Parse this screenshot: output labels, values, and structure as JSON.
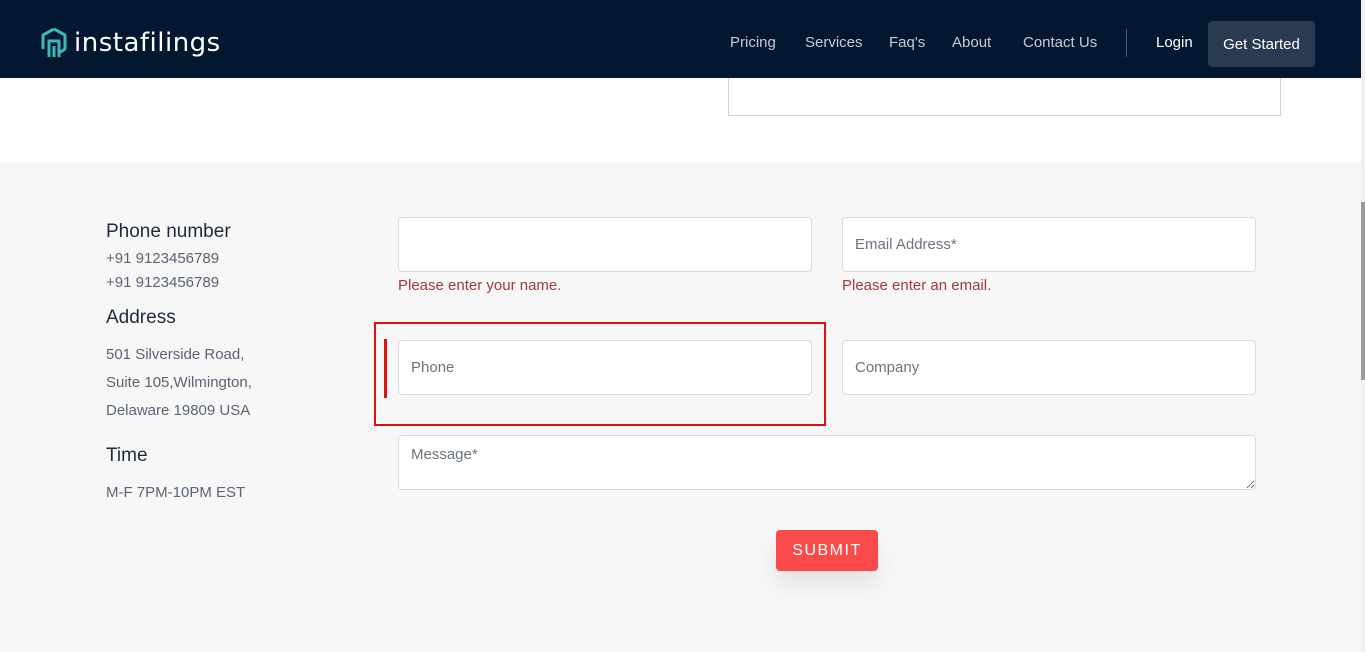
{
  "brand": {
    "name": "instafilings"
  },
  "nav": {
    "links": [
      "Pricing",
      "Services",
      "Faq's",
      "About",
      "Contact Us"
    ],
    "login": "Login",
    "get_started": "Get Started"
  },
  "contact_info": {
    "phone_heading": "Phone number",
    "phones": [
      "+91 9123456789",
      "+91 9123456789"
    ],
    "address_heading": "Address",
    "address_lines": [
      "501 Silverside Road,",
      "Suite 105,Wilmington,",
      "Delaware 19809 USA"
    ],
    "time_heading": "Time",
    "time_value": "M-F 7PM-10PM EST"
  },
  "form": {
    "name": {
      "value": "",
      "placeholder": "",
      "error": "Please enter your name."
    },
    "email": {
      "value": "",
      "placeholder": "Email Address*",
      "error": "Please enter an email."
    },
    "phone": {
      "value": "",
      "placeholder": "Phone"
    },
    "company": {
      "value": "",
      "placeholder": "Company"
    },
    "message": {
      "value": "",
      "placeholder": "Message*"
    },
    "submit_label": "SUBMIT"
  },
  "colors": {
    "nav_bg": "#041730",
    "submit_bg": "#fb4a4a",
    "error_text": "#a33a3a",
    "highlight": "#e01010",
    "logo_accent": "#3bb8b8"
  }
}
